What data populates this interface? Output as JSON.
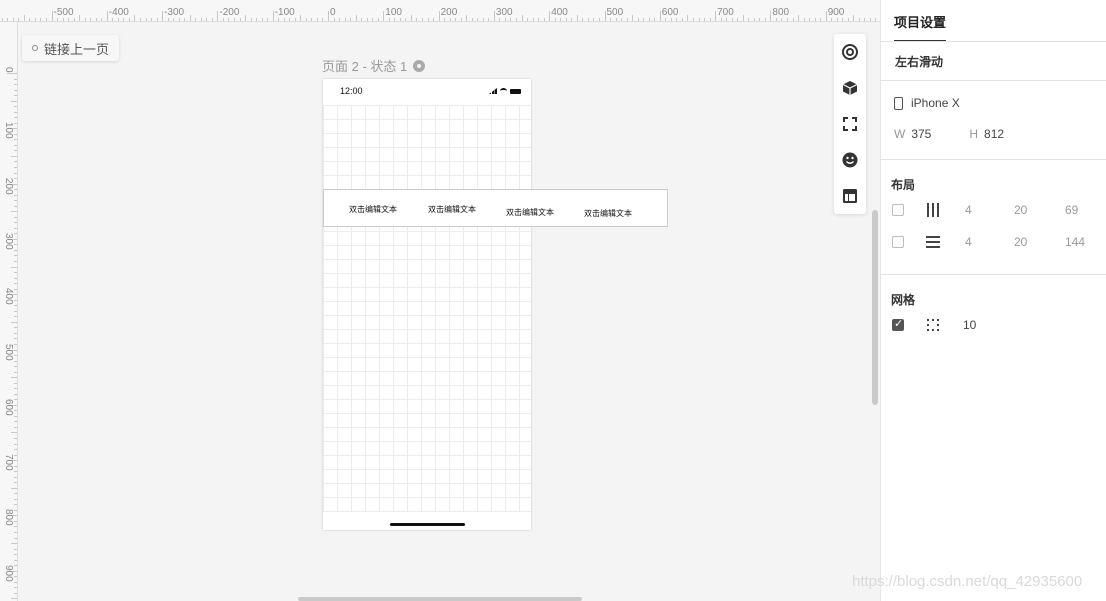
{
  "ruler": {
    "h_labels": [
      "-500",
      "-400",
      "-300",
      "-200",
      "-100",
      "0",
      "100",
      "200",
      "300",
      "400",
      "500",
      "600",
      "700",
      "800",
      "900"
    ],
    "v_labels": [
      "0",
      "100",
      "200",
      "300",
      "400",
      "500",
      "600",
      "700",
      "800",
      "900"
    ]
  },
  "canvas": {
    "link_prev_label": "链接上一页",
    "page_title": "页面 2 - 状态 1",
    "status_time": "12:00",
    "swipe_items": [
      "双击编辑文本",
      "双击编辑文本",
      "双击编辑文本",
      "双击编辑文本"
    ]
  },
  "toolbar": {
    "icons": [
      "target-icon",
      "cube-icon",
      "focus-frame-icon",
      "smiley-icon",
      "layout-icon"
    ]
  },
  "panel": {
    "tab_label": "项目设置",
    "interaction_label": "左右滑动",
    "device_name": "iPhone X",
    "width_label": "W",
    "width_value": "375",
    "height_label": "H",
    "height_value": "812",
    "layout_title": "布局",
    "columns": {
      "checked": false,
      "count": "4",
      "gutter": "20",
      "margin": "69"
    },
    "rows": {
      "checked": false,
      "count": "4",
      "gutter": "20",
      "margin": "144"
    },
    "grid_title": "网格",
    "grid": {
      "checked": true,
      "size": "10"
    }
  },
  "watermark": "https://blog.csdn.net/qq_42935600",
  "colors": {
    "canvas_bg": "#f4f4f4",
    "accent": "#333333",
    "muted": "#999999"
  }
}
